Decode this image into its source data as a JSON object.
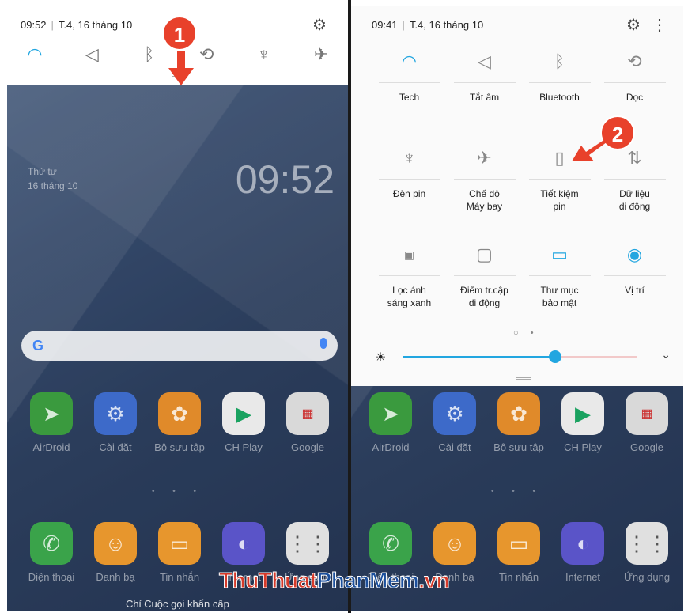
{
  "left_screen": {
    "status": {
      "time": "09:52",
      "date": "T.4, 16 tháng 10"
    },
    "quick_icons": [
      "wifi-icon",
      "mute-icon",
      "bluetooth-icon",
      "rotate-icon",
      "flashlight-icon",
      "airplane-icon"
    ],
    "lock": {
      "clock": "09:52",
      "day": "Thứ tư",
      "date": "16 tháng 10"
    },
    "search": {
      "logo": "G"
    },
    "apps_row1": [
      {
        "label": "AirDroid",
        "icon": "airdroid-icon",
        "color": "#3a9a3e"
      },
      {
        "label": "Cài đặt",
        "icon": "settings-icon",
        "color": "#3d6ac9"
      },
      {
        "label": "Bộ sưu tập",
        "icon": "gallery-icon",
        "color": "#e08a2a"
      },
      {
        "label": "CH Play",
        "icon": "play-store-icon",
        "color": "#e9e9e9"
      },
      {
        "label": "Google",
        "icon": "google-folder-icon",
        "color": "#d9d9d9"
      }
    ],
    "apps_row2": [
      {
        "label": "Điện thoại",
        "icon": "phone-icon",
        "color": "#3aa34a"
      },
      {
        "label": "Danh bạ",
        "icon": "contacts-icon",
        "color": "#e7962d"
      },
      {
        "label": "Tin nhắn",
        "icon": "messages-icon",
        "color": "#e7962d"
      },
      {
        "label": "Internet",
        "icon": "internet-icon",
        "color": "#5a54c8"
      },
      {
        "label": "Ứng dụng",
        "icon": "apps-icon",
        "color": "#e0e0e0"
      }
    ],
    "emergency": "Chỉ Cuộc gọi khẩn cấp",
    "badge": "1"
  },
  "right_screen": {
    "status": {
      "time": "09:41",
      "date": "T.4, 16 tháng 10"
    },
    "tiles": [
      {
        "label": "Tech",
        "icon": "wifi-icon",
        "on": true
      },
      {
        "label": "Tắt âm",
        "icon": "mute-icon",
        "on": false
      },
      {
        "label": "Bluetooth",
        "icon": "bluetooth-icon",
        "on": false
      },
      {
        "label": "Dọc",
        "icon": "rotate-icon",
        "on": false
      },
      {
        "label": "Đèn pin",
        "icon": "flashlight-icon",
        "on": false
      },
      {
        "label": "Chế độ\nMáy bay",
        "icon": "airplane-icon",
        "on": false
      },
      {
        "label": "Tiết kiệm\npin",
        "icon": "battery-saver-icon",
        "on": false
      },
      {
        "label": "Dữ liệu\ndi động",
        "icon": "mobile-data-icon",
        "on": false
      },
      {
        "label": "Lọc ánh\nsáng xanh",
        "icon": "blue-light-icon",
        "on": false
      },
      {
        "label": "Điểm tr.cập\ndi động",
        "icon": "hotspot-icon",
        "on": false
      },
      {
        "label": "Thư mục\nbảo mật",
        "icon": "secure-folder-icon",
        "on": true
      },
      {
        "label": "Vị trí",
        "icon": "location-icon",
        "on": true
      }
    ],
    "brightness": 0.65,
    "badge": "2",
    "apps_row1": [
      "AirDroid",
      "Cài đặt",
      "Bộ sưu tập",
      "CH Play",
      "Google"
    ],
    "apps_row2": [
      "Điện thoại",
      "Danh bạ",
      "Tin nhắn",
      "Internet",
      "Ứng dụng"
    ]
  },
  "watermark": {
    "part1": "ThuThuat",
    "part2": "PhanMem",
    "part3": ".vn"
  },
  "colors": {
    "accent": "#22a6e0",
    "badge": "#e8412b"
  }
}
